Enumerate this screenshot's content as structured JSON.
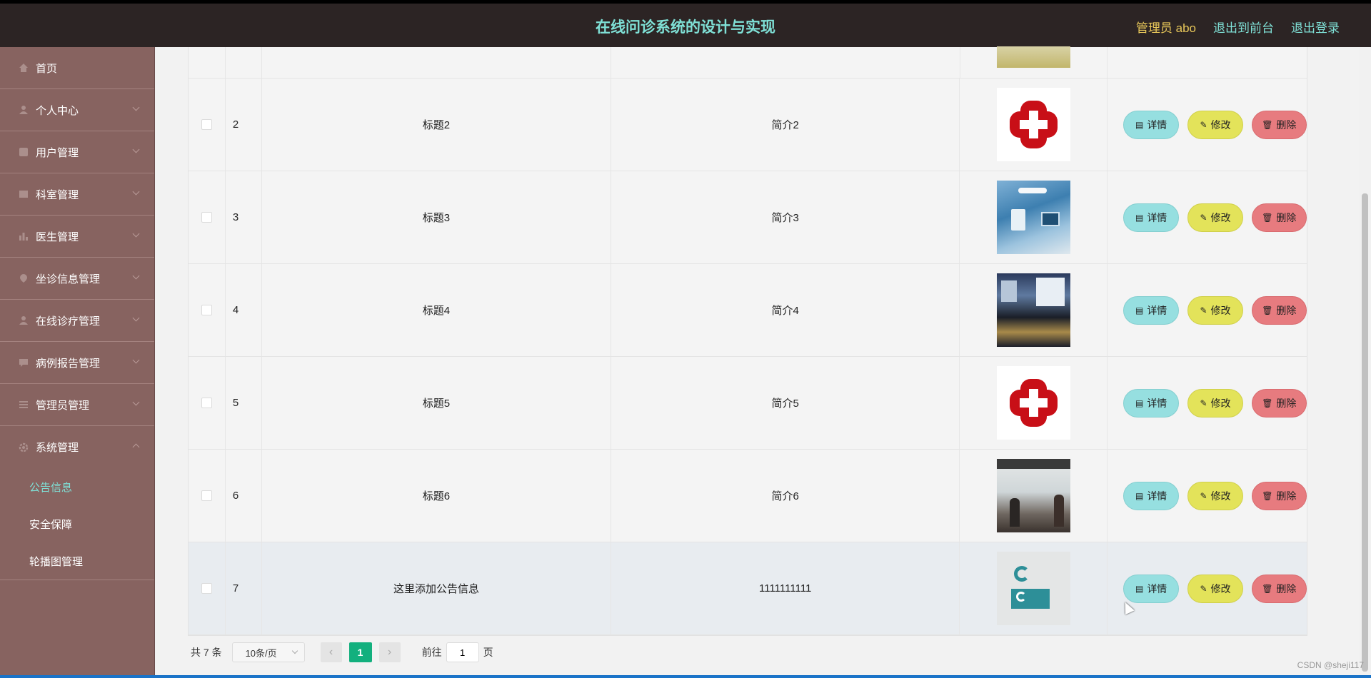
{
  "header": {
    "title": "在线问诊系统的设计与实现",
    "admin_label": "管理员 abo",
    "to_front_label": "退出到前台",
    "logout_label": "退出登录"
  },
  "sidebar": {
    "items": [
      {
        "label": "首页",
        "icon": "home-icon"
      },
      {
        "label": "个人中心",
        "icon": "user-icon"
      },
      {
        "label": "用户管理",
        "icon": "users-icon"
      },
      {
        "label": "科室管理",
        "icon": "department-icon"
      },
      {
        "label": "医生管理",
        "icon": "chart-icon"
      },
      {
        "label": "坐诊信息管理",
        "icon": "location-icon"
      },
      {
        "label": "在线诊疗管理",
        "icon": "user-icon"
      },
      {
        "label": "病例报告管理",
        "icon": "message-icon"
      },
      {
        "label": "管理员管理",
        "icon": "list-icon"
      },
      {
        "label": "系统管理",
        "icon": "gear-icon"
      }
    ],
    "sub_items": [
      "公告信息",
      "安全保障",
      "轮播图管理"
    ],
    "active_sub": "公告信息"
  },
  "table": {
    "rows": [
      {
        "index": "2",
        "title": "标题2",
        "intro": "简介2",
        "image": "red-cross"
      },
      {
        "index": "3",
        "title": "标题3",
        "intro": "简介3",
        "image": "operating-room"
      },
      {
        "index": "4",
        "title": "标题4",
        "intro": "简介4",
        "image": "hall"
      },
      {
        "index": "5",
        "title": "标题5",
        "intro": "简介5",
        "image": "red-cross"
      },
      {
        "index": "6",
        "title": "标题6",
        "intro": "简介6",
        "image": "lobby"
      },
      {
        "index": "7",
        "title": "这里添加公告信息",
        "intro": "1111111111",
        "image": "logo"
      }
    ],
    "actions": {
      "detail": "详情",
      "edit": "修改",
      "delete": "删除"
    }
  },
  "pagination": {
    "total": "共 7 条",
    "page_size": "10条/页",
    "current_page": "1",
    "goto_prefix": "前往",
    "goto_value": "1",
    "goto_suffix": "页"
  },
  "watermark": "CSDN @sheji117",
  "colors": {
    "header_bg": "#2c2424",
    "title": "#7fe0d6",
    "sidebar_bg": "#876360",
    "detail_btn": "#96dfe0",
    "edit_btn": "#e3e35a",
    "delete_btn": "#e77b7f",
    "page_active": "#13b07e"
  }
}
